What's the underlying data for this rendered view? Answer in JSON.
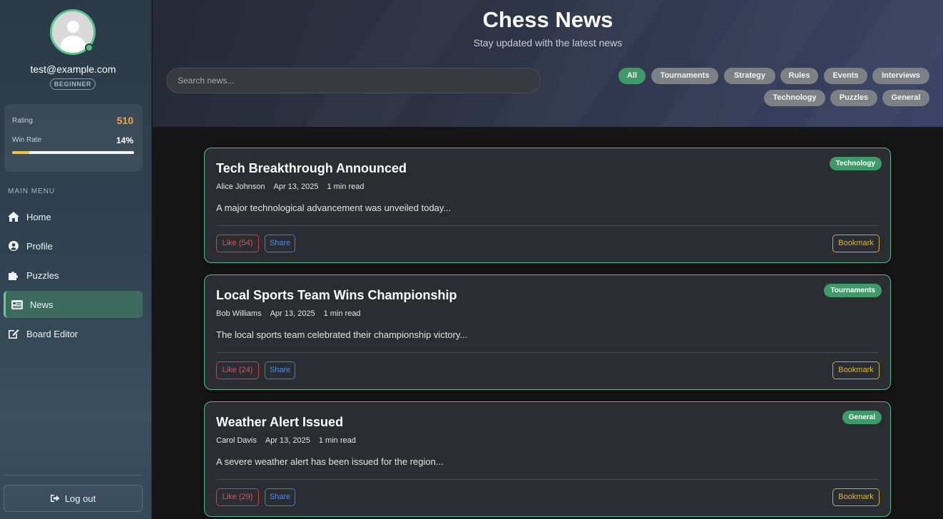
{
  "user": {
    "email": "test@example.com",
    "level": "BEGINNER",
    "stats": {
      "rating_label": "Rating",
      "rating_value": "510",
      "winrate_label": "Win Rate",
      "winrate_value": "14%",
      "winrate_fraction": 0.14
    }
  },
  "sidebar": {
    "menu_title": "MAIN MENU",
    "items": [
      {
        "label": "Home",
        "icon": "home-icon"
      },
      {
        "label": "Profile",
        "icon": "user-circle-icon"
      },
      {
        "label": "Puzzles",
        "icon": "puzzle-icon"
      },
      {
        "label": "News",
        "icon": "newspaper-icon",
        "active": true
      },
      {
        "label": "Board Editor",
        "icon": "edit-icon"
      }
    ],
    "logout_label": "Log out"
  },
  "header": {
    "title": "Chess News",
    "subtitle": "Stay updated with the latest news",
    "search_placeholder": "Search news...",
    "filters": [
      "All",
      "Tournaments",
      "Strategy",
      "Rules",
      "Events",
      "Interviews",
      "Technology",
      "Puzzles",
      "General"
    ],
    "active_filter": "All"
  },
  "articles": [
    {
      "title": "Tech Breakthrough Announced",
      "author": "Alice Johnson",
      "date": "Apr 13, 2025",
      "read_time": "1 min read",
      "excerpt": "A major technological advancement was unveiled today...",
      "category": "Technology",
      "like_label": "Like (54)",
      "share_label": "Share",
      "bookmark_label": "Bookmark"
    },
    {
      "title": "Local Sports Team Wins Championship",
      "author": "Bob Williams",
      "date": "Apr 13, 2025",
      "read_time": "1 min read",
      "excerpt": "The local sports team celebrated their championship victory...",
      "category": "Tournaments",
      "like_label": "Like (24)",
      "share_label": "Share",
      "bookmark_label": "Bookmark"
    },
    {
      "title": "Weather Alert Issued",
      "author": "Carol Davis",
      "date": "Apr 13, 2025",
      "read_time": "1 min read",
      "excerpt": "A severe weather alert has been issued for the region...",
      "category": "General",
      "like_label": "Like (29)",
      "share_label": "Share",
      "bookmark_label": "Bookmark"
    }
  ],
  "colors": {
    "accent_green": "#3f9a6a",
    "rating_orange": "#f4a640",
    "like_red": "#c9424f",
    "share_blue": "#3a7fd4",
    "bookmark_gold": "#d9a92a"
  }
}
